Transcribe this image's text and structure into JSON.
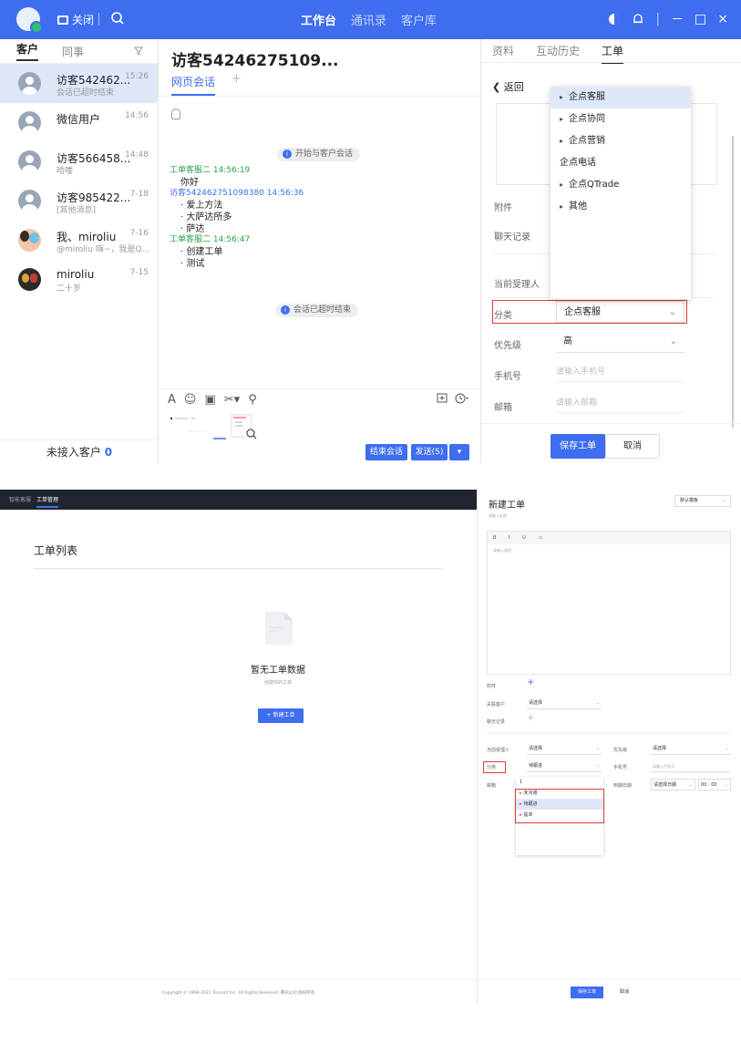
{
  "top": {
    "titlebar": {
      "close_label": "关闭",
      "tabs": [
        {
          "label": "工作台",
          "active": true
        },
        {
          "label": "通讯录",
          "active": false
        },
        {
          "label": "客户库",
          "active": false
        }
      ],
      "window_controls": [
        "－",
        "□",
        "×"
      ],
      "accent": "#3e6df0"
    },
    "chat_list": {
      "tabs": [
        "客户",
        "同事"
      ],
      "items": [
        {
          "name": "访客542462...",
          "time": "15:26",
          "sub": "会话已超时结束",
          "avatar": "default",
          "selected": true
        },
        {
          "name": "微信用户",
          "time": "14:56",
          "sub": "",
          "avatar": "default",
          "selected": false
        },
        {
          "name": "访客566458...",
          "time": "14:48",
          "sub": "哈喽",
          "avatar": "default",
          "selected": false
        },
        {
          "name": "访客985422...",
          "time": "7-18",
          "sub": "[其他消息]",
          "avatar": "default",
          "selected": false
        },
        {
          "name": "我、miroliu",
          "time": "7-16",
          "sub": "@miroliu 嗨~，我是Q...",
          "avatar": "photo",
          "selected": false
        },
        {
          "name": "miroliu",
          "time": "7-15",
          "sub": "二十岁",
          "avatar": "dark",
          "selected": false
        }
      ],
      "footer_label": "未接入客户",
      "footer_count": "0"
    },
    "chat": {
      "title": "访客54246275109...",
      "tab": "网页会话",
      "plus": "+",
      "start_notice": "开始与客户会话",
      "messages": [
        {
          "sender": "工单客服二 14:56:19",
          "role": "agent",
          "lines": [
            "你好"
          ]
        },
        {
          "sender": "访客542462751098380 14:56:36",
          "role": "visitor",
          "lines": [
            "· 爱上方法",
            "· 大萨达所多",
            "· 萨达"
          ]
        },
        {
          "sender": "工单客服二 14:56:47",
          "role": "agent",
          "lines": [
            "· 创建工单",
            "· 测试"
          ]
        }
      ],
      "end_notice": "会话已超时结束",
      "toolbar_icons": [
        "A",
        "☺",
        "▣",
        "✂▾",
        "⚲"
      ],
      "end_button": "结束会话",
      "send_button": "发送(S)",
      "send_arrow": "▾"
    },
    "ticket_panel": {
      "tabs": [
        {
          "label": "资料",
          "active": false
        },
        {
          "label": "互动历史",
          "active": false
        },
        {
          "label": "工单",
          "active": true
        }
      ],
      "back_label": "返回",
      "labels": {
        "attachment": "附件",
        "chat_record": "聊天记录",
        "assignee": "当前受理人",
        "category": "分类",
        "priority": "优先级",
        "phone": "手机号",
        "email": "邮箱"
      },
      "category_value": "企点客服",
      "priority_value": "高",
      "phone_placeholder": "请输入手机号",
      "email_placeholder": "请输入邮箱",
      "dropdown": [
        {
          "label": "企点客服",
          "arrow": true,
          "highlighted": true
        },
        {
          "label": "企点协同",
          "arrow": true,
          "highlighted": false
        },
        {
          "label": "企点营销",
          "arrow": true,
          "highlighted": false
        },
        {
          "label": "企点电话",
          "arrow": false,
          "highlighted": false
        },
        {
          "label": "企点QTrade",
          "arrow": true,
          "highlighted": false
        },
        {
          "label": "其他",
          "arrow": true,
          "highlighted": false
        }
      ],
      "save_button": "保存工单",
      "cancel_button": "取消"
    }
  },
  "bottom": {
    "nav": [
      {
        "label": "智能客服",
        "active": false
      },
      {
        "label": "工单管理",
        "active": true
      }
    ],
    "list_title": "工单列表",
    "empty_title": "暂无工单数据",
    "empty_sub": "创建你的工单",
    "new_button": "+ 新建工单",
    "copyright": "Copyright © 1998-2021 Tencent Inc. All Rights Reserved. 腾讯公司 版权所有",
    "form": {
      "title": "新建工单",
      "template": "默认模板",
      "title_placeholder": "请输入标题",
      "editor_tools": "B I U ▭",
      "editor_placeholder": "请输入描述",
      "labels": {
        "attachment": "附件",
        "customer": "关联客户",
        "chat_record": "聊天记录",
        "assignee": "当前受理人",
        "priority": "优先级",
        "category": "分类",
        "phone": "手机号",
        "email": "邮箱",
        "due_date": "到期日期"
      },
      "customer_value": "请选择",
      "assignee_value": "请选择",
      "priority_value": "请选择",
      "category_value": "待跟进",
      "phone_placeholder": "请输入手机号",
      "date_placeholder": "请选择日期",
      "time_placeholder": "00 : 00",
      "dropdown": [
        {
          "label": "1",
          "arrow": false,
          "highlighted": false
        },
        {
          "label": "未沟通",
          "arrow": true,
          "highlighted": false
        },
        {
          "label": "待跟进",
          "arrow": true,
          "highlighted": true
        },
        {
          "label": "提单",
          "arrow": true,
          "highlighted": false
        }
      ],
      "save_button": "保存工单",
      "cancel_button": "取消"
    }
  }
}
